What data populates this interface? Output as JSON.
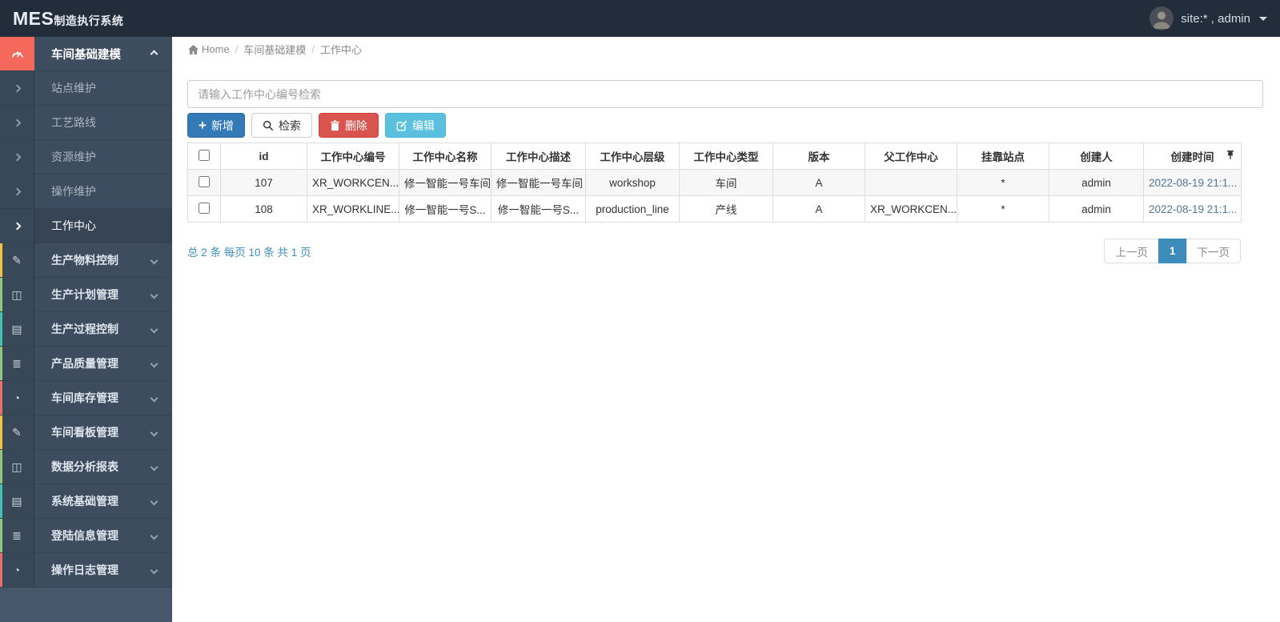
{
  "navbar": {
    "brand_mes": "MES",
    "brand_rest": "制造执行系统",
    "user_label": "site:* , admin"
  },
  "breadcrumb": {
    "home": "Home",
    "level1": "车间基础建模",
    "level2": "工作中心"
  },
  "sidebar": {
    "active_group": {
      "label": "车间基础建模",
      "icon": "gauge-icon"
    },
    "sub_items": [
      {
        "label": "站点维护",
        "active": false
      },
      {
        "label": "工艺路线",
        "active": false
      },
      {
        "label": "资源维护",
        "active": false
      },
      {
        "label": "操作维护",
        "active": false
      },
      {
        "label": "工作中心",
        "active": true
      }
    ],
    "groups": [
      {
        "label": "生产物料控制",
        "icon": "pencil-icon",
        "accent": "#eec33f"
      },
      {
        "label": "生产计划管理",
        "icon": "columns-icon",
        "accent": "#8fc876"
      },
      {
        "label": "生产过程控制",
        "icon": "book-icon",
        "accent": "#43c0b4"
      },
      {
        "label": "产品质量管理",
        "icon": "list-icon",
        "accent": "#8fc876"
      },
      {
        "label": "车间库存管理",
        "icon": "gauge-icon",
        "accent": "#ec6e64"
      },
      {
        "label": "车间看板管理",
        "icon": "pencil-icon",
        "accent": "#eec33f"
      },
      {
        "label": "数据分析报表",
        "icon": "columns-icon",
        "accent": "#8fc876"
      },
      {
        "label": "系统基础管理",
        "icon": "book-icon",
        "accent": "#43c0b4"
      },
      {
        "label": "登陆信息管理",
        "icon": "list-icon",
        "accent": "#8fc876"
      },
      {
        "label": "操作日志管理",
        "icon": "gauge-icon",
        "accent": "#ec6e64"
      }
    ]
  },
  "toolbar": {
    "search_placeholder": "请输入工作中心编号检索",
    "add_label": "新增",
    "search_label": "检索",
    "delete_label": "删除",
    "edit_label": "编辑"
  },
  "table": {
    "headers": [
      "id",
      "工作中心编号",
      "工作中心名称",
      "工作中心描述",
      "工作中心层级",
      "工作中心类型",
      "版本",
      "父工作中心",
      "挂靠站点",
      "创建人",
      "创建时间"
    ],
    "rows": [
      [
        "107",
        "XR_WORKCEN...",
        "修一智能一号车间",
        "修一智能一号车间",
        "workshop",
        "车间",
        "A",
        "",
        "*",
        "admin",
        "2022-08-19 21:1..."
      ],
      [
        "108",
        "XR_WORKLINE...",
        "修一智能一号S...",
        "修一智能一号S...",
        "production_line",
        "产线",
        "A",
        "XR_WORKCEN...",
        "*",
        "admin",
        "2022-08-19 21:1..."
      ]
    ]
  },
  "pagination": {
    "summary": "总 2 条 每页 10 条 共 1 页",
    "prev_label": "上一页",
    "current_page": "1",
    "next_label": "下一页"
  },
  "colors": {
    "navbar_bg": "#222d3b",
    "sidebar_bg": "#47566a",
    "item_bg": "#3d4c5f",
    "accent_salmon": "#f4695c",
    "primary": "#337ab7",
    "danger": "#d9534f",
    "info": "#5bc0de",
    "active_page": "#3c8dbc"
  }
}
